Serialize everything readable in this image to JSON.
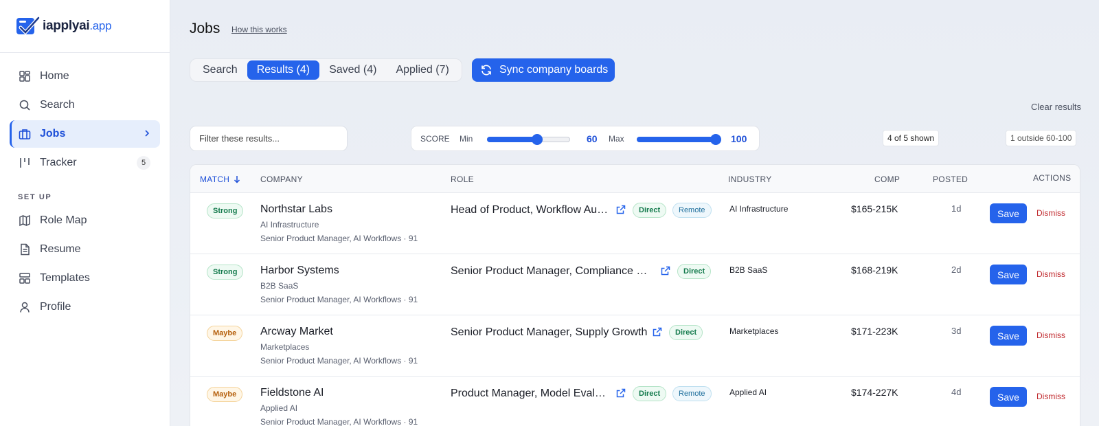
{
  "brand": {
    "name": "iapplyai",
    "suffix": ".app"
  },
  "nav": {
    "items": [
      {
        "label": "Home",
        "icon": "dashboard-icon"
      },
      {
        "label": "Search",
        "icon": "search-icon"
      },
      {
        "label": "Jobs",
        "icon": "briefcase-icon",
        "active": true
      },
      {
        "label": "Tracker",
        "icon": "tracker-icon",
        "badge": "5"
      }
    ],
    "section_label": "SET UP",
    "setup_items": [
      {
        "label": "Role Map",
        "icon": "map-icon"
      },
      {
        "label": "Resume",
        "icon": "document-icon"
      },
      {
        "label": "Templates",
        "icon": "templates-icon"
      },
      {
        "label": "Profile",
        "icon": "user-icon"
      }
    ]
  },
  "header": {
    "title": "Jobs",
    "how_link": "How this works"
  },
  "tabs": [
    {
      "label": "Search"
    },
    {
      "label": "Results (4)",
      "active": true
    },
    {
      "label": "Saved (4)"
    },
    {
      "label": "Applied (7)"
    }
  ],
  "sync_button": "Sync company boards",
  "clear_results": "Clear results",
  "filter": {
    "placeholder": "Filter these results..."
  },
  "score": {
    "label": "SCORE",
    "min_label": "Min",
    "min_value": "60",
    "max_label": "Max",
    "max_value": "100"
  },
  "counts": {
    "shown": "4 of 5 shown",
    "outside": "1 outside 60-100"
  },
  "table": {
    "headers": {
      "match": "MATCH",
      "company": "COMPANY",
      "role": "ROLE",
      "industry": "INDUSTRY",
      "comp": "COMP",
      "posted": "POSTED",
      "actions": "ACTIONS"
    },
    "save_label": "Save",
    "dismiss_label": "Dismiss",
    "rows": [
      {
        "match": "Strong",
        "company": "Northstar Labs",
        "industry": "AI Infrastructure",
        "meta": "Senior Product Manager, AI Workflows · 91",
        "role": "Head of Product, Workflow Automation",
        "tags": [
          "Direct",
          "Remote"
        ],
        "comp": "$165-215K",
        "posted": "1d"
      },
      {
        "match": "Strong",
        "company": "Harbor Systems",
        "industry": "B2B SaaS",
        "meta": "Senior Product Manager, AI Workflows · 91",
        "role": "Senior Product Manager, Compliance Platform",
        "tags": [
          "Direct"
        ],
        "comp": "$168-219K",
        "posted": "2d"
      },
      {
        "match": "Maybe",
        "company": "Arcway Market",
        "industry": "Marketplaces",
        "meta": "Senior Product Manager, AI Workflows · 91",
        "role": "Senior Product Manager, Supply Growth",
        "tags": [
          "Direct"
        ],
        "comp": "$171-223K",
        "posted": "3d"
      },
      {
        "match": "Maybe",
        "company": "Fieldstone AI",
        "industry": "Applied AI",
        "meta": "Senior Product Manager, AI Workflows · 91",
        "role": "Product Manager, Model Evaluation",
        "tags": [
          "Direct",
          "Remote"
        ],
        "comp": "$174-227K",
        "posted": "4d"
      }
    ]
  }
}
